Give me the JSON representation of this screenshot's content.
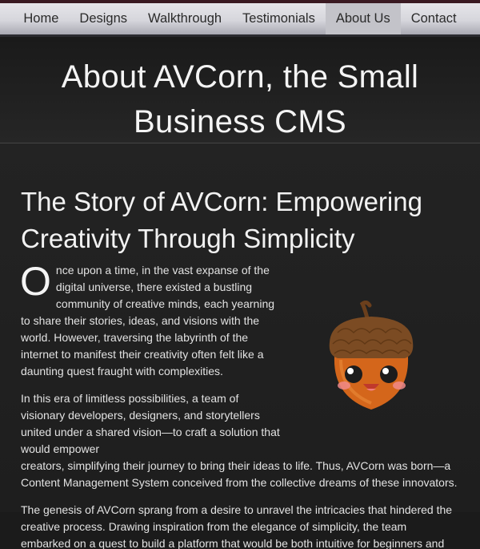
{
  "nav": {
    "items": [
      {
        "label": "Home",
        "active": false
      },
      {
        "label": "Designs",
        "active": false
      },
      {
        "label": "Walkthrough",
        "active": false
      },
      {
        "label": "Testimonials",
        "active": false
      },
      {
        "label": "About Us",
        "active": true
      },
      {
        "label": "Contact",
        "active": false
      }
    ]
  },
  "hero": {
    "title_line1": "About AVCorn, the Small",
    "title_line2": "Business CMS"
  },
  "story": {
    "title_line1": "The Story of AVCorn: Empowering",
    "title_line2": "Creativity Through Simplicity",
    "p1_drop_cap": "O",
    "p1_rest": "nce upon a time, in the vast expanse of the digital universe, there existed a bustling community of creative minds, each yearning to share their stories, ideas, and visions with the world. However, traversing the labyrinth of the internet to manifest their creativity often felt like a daunting quest fraught with complexities.",
    "p2_part1": "In this era of limitless possibilities, a team of visionary developers, designers, and storytellers united under a shared vision—to craft a solution that would empower",
    "p2_part2": "creators, simplifying their journey to bring their ideas to life. Thus, AVCorn was born—a Content Management System conceived from the collective dreams of these innovators.",
    "p3": "The genesis of AVCorn sprang from a desire to unravel the intricacies that hindered the creative process. Drawing inspiration from the elegance of simplicity, the team embarked on a quest to build a platform that would be both intuitive for beginners and robust for seasoned content creators."
  },
  "mascot": {
    "icon": "acorn-mascot-icon"
  },
  "colors": {
    "background": "#1b1b1b",
    "nav_bg": "#dcdce0",
    "nav_active": "#c3c3c9",
    "acorn_cap": "#7a4a22",
    "acorn_body": "#d76a1c"
  }
}
